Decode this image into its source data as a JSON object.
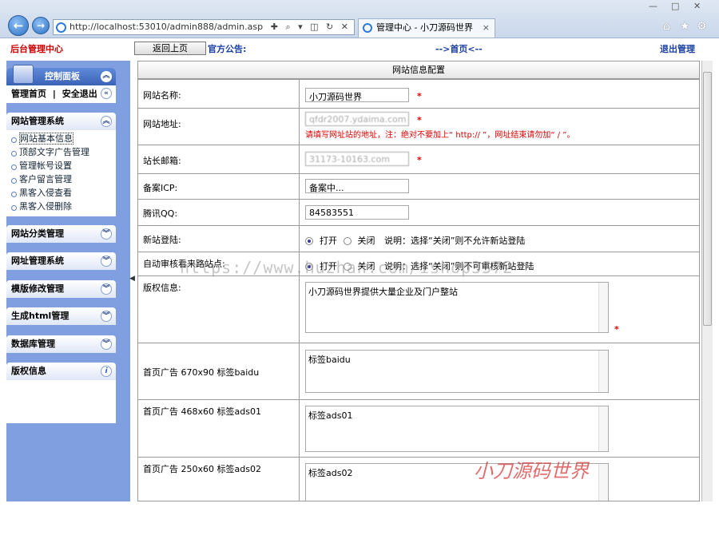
{
  "browser": {
    "url": "http://localhost:53010/admin888/admin.asp",
    "tab_title": "管理中心 - 小刀源码世界",
    "tab_close": "×",
    "addr_tools": "✚ ⌕ ▾ ◫ ↻ ✕",
    "window_controls": [
      "—",
      "□",
      "✕"
    ]
  },
  "topbar": {
    "brand": "后台管理中心",
    "back_label": "返回上页",
    "notice": "官方公告:",
    "home": "-->首页<--",
    "logout": "退出管理"
  },
  "sidebar": {
    "control_panel": "控制面板",
    "admin_home": "管理首页",
    "sep": "|",
    "safe_exit": "安全退出",
    "site_mgmt": {
      "title": "网站管理系统",
      "items": [
        "网站基本信息",
        "顶部文字广告管理",
        "管理帐号设置",
        "客户留言管理",
        "黑客入侵查看",
        "黑客入侵删除"
      ]
    },
    "sections": [
      "网站分类管理",
      "网址管理系统",
      "模版修改管理",
      "生成html管理",
      "数据库管理"
    ],
    "copyright": "版权信息"
  },
  "form": {
    "title": "网站信息配置",
    "site_name_label": "网站名称:",
    "site_name_value": "小刀源码世界",
    "site_url_label": "网站地址:",
    "site_url_value": "qfdr2007.ydaima.com",
    "site_url_hint": "请填写网址站的地址，注：绝对不要加上“ http:// ”，网址结束请勿加“ / ”。",
    "email_label": "站长邮箱:",
    "email_value": "31173-10163.com",
    "icp_label": "备案ICP:",
    "icp_value": "备案中...",
    "qq_label": "腾讯QQ:",
    "qq_value": "84583551",
    "register_label": "新站登陆:",
    "register_on": "打开",
    "register_off": "关闭",
    "register_note": "说明：选择“关闭”则不允许新站登陆",
    "audit_label": "自动审核看来路站点:",
    "audit_on": "打开",
    "audit_off": "关闭",
    "audit_note": "说明：选择“关闭”则不可审核新站登陆",
    "copyright_label": "版权信息:",
    "copyright_value": "小刀源码世界提供大量企业及门户整站",
    "ad1_label": "首页广告 670x90 标签baidu",
    "ad1_value": "标签baidu",
    "ad2_label": "首页广告 468x60 标签ads01",
    "ad2_value": "标签ads01",
    "ad3_label": "首页广告 250x60 标签ads02",
    "ad3_value": "标签ads02",
    "required": "*"
  },
  "watermark": {
    "url": "https://www.huzhan.com/ishop3572",
    "brand": "小刀源码世界"
  }
}
